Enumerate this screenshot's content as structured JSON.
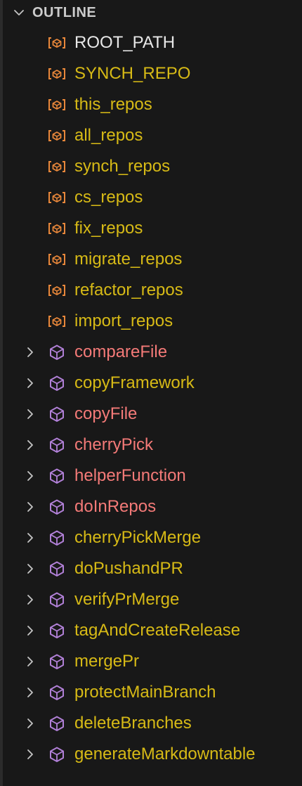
{
  "outline": {
    "title": "OUTLINE",
    "items": [
      {
        "label": "ROOT_PATH",
        "kind": "variable",
        "color": "#e8e8e8",
        "expandable": false,
        "icon": "variable-icon"
      },
      {
        "label": "SYNCH_REPO",
        "kind": "variable",
        "color": "#d7ba16",
        "expandable": false,
        "icon": "variable-icon"
      },
      {
        "label": "this_repos",
        "kind": "variable",
        "color": "#d7ba16",
        "expandable": false,
        "icon": "variable-icon"
      },
      {
        "label": "all_repos",
        "kind": "variable",
        "color": "#d7ba16",
        "expandable": false,
        "icon": "variable-icon"
      },
      {
        "label": "synch_repos",
        "kind": "variable",
        "color": "#d7ba16",
        "expandable": false,
        "icon": "variable-icon"
      },
      {
        "label": "cs_repos",
        "kind": "variable",
        "color": "#d7ba16",
        "expandable": false,
        "icon": "variable-icon"
      },
      {
        "label": "fix_repos",
        "kind": "variable",
        "color": "#d7ba16",
        "expandable": false,
        "icon": "variable-icon"
      },
      {
        "label": "migrate_repos",
        "kind": "variable",
        "color": "#d7ba16",
        "expandable": false,
        "icon": "variable-icon"
      },
      {
        "label": "refactor_repos",
        "kind": "variable",
        "color": "#d7ba16",
        "expandable": false,
        "icon": "variable-icon"
      },
      {
        "label": "import_repos",
        "kind": "variable",
        "color": "#d7ba16",
        "expandable": false,
        "icon": "variable-icon"
      },
      {
        "label": "compareFile",
        "kind": "function",
        "color": "#f47a78",
        "expandable": true,
        "icon": "method-cube-icon"
      },
      {
        "label": "copyFramework",
        "kind": "function",
        "color": "#d7ba16",
        "expandable": true,
        "icon": "method-cube-icon"
      },
      {
        "label": "copyFile",
        "kind": "function",
        "color": "#f47a78",
        "expandable": true,
        "icon": "method-cube-icon"
      },
      {
        "label": "cherryPick",
        "kind": "function",
        "color": "#f47a78",
        "expandable": true,
        "icon": "method-cube-icon"
      },
      {
        "label": "helperFunction",
        "kind": "function",
        "color": "#f47a78",
        "expandable": true,
        "icon": "method-cube-icon"
      },
      {
        "label": "doInRepos",
        "kind": "function",
        "color": "#f47a78",
        "expandable": true,
        "icon": "method-cube-icon"
      },
      {
        "label": "cherryPickMerge",
        "kind": "function",
        "color": "#d7ba16",
        "expandable": true,
        "icon": "method-cube-icon"
      },
      {
        "label": "doPushandPR",
        "kind": "function",
        "color": "#d7ba16",
        "expandable": true,
        "icon": "method-cube-icon"
      },
      {
        "label": "verifyPrMerge",
        "kind": "function",
        "color": "#d7ba16",
        "expandable": true,
        "icon": "method-cube-icon"
      },
      {
        "label": "tagAndCreateRelease",
        "kind": "function",
        "color": "#d7ba16",
        "expandable": true,
        "icon": "method-cube-icon"
      },
      {
        "label": "mergePr",
        "kind": "function",
        "color": "#d7ba16",
        "expandable": true,
        "icon": "method-cube-icon"
      },
      {
        "label": "protectMainBranch",
        "kind": "function",
        "color": "#d7ba16",
        "expandable": true,
        "icon": "method-cube-icon"
      },
      {
        "label": "deleteBranches",
        "kind": "function",
        "color": "#d7ba16",
        "expandable": true,
        "icon": "method-cube-icon"
      },
      {
        "label": "generateMarkdowntable",
        "kind": "function",
        "color": "#d7ba16",
        "expandable": true,
        "icon": "method-cube-icon"
      }
    ]
  },
  "colors": {
    "background": "#181818",
    "variable_icon": "#e8873a",
    "method_icon": "#b180d7",
    "chevron": "#c5c5c5"
  }
}
